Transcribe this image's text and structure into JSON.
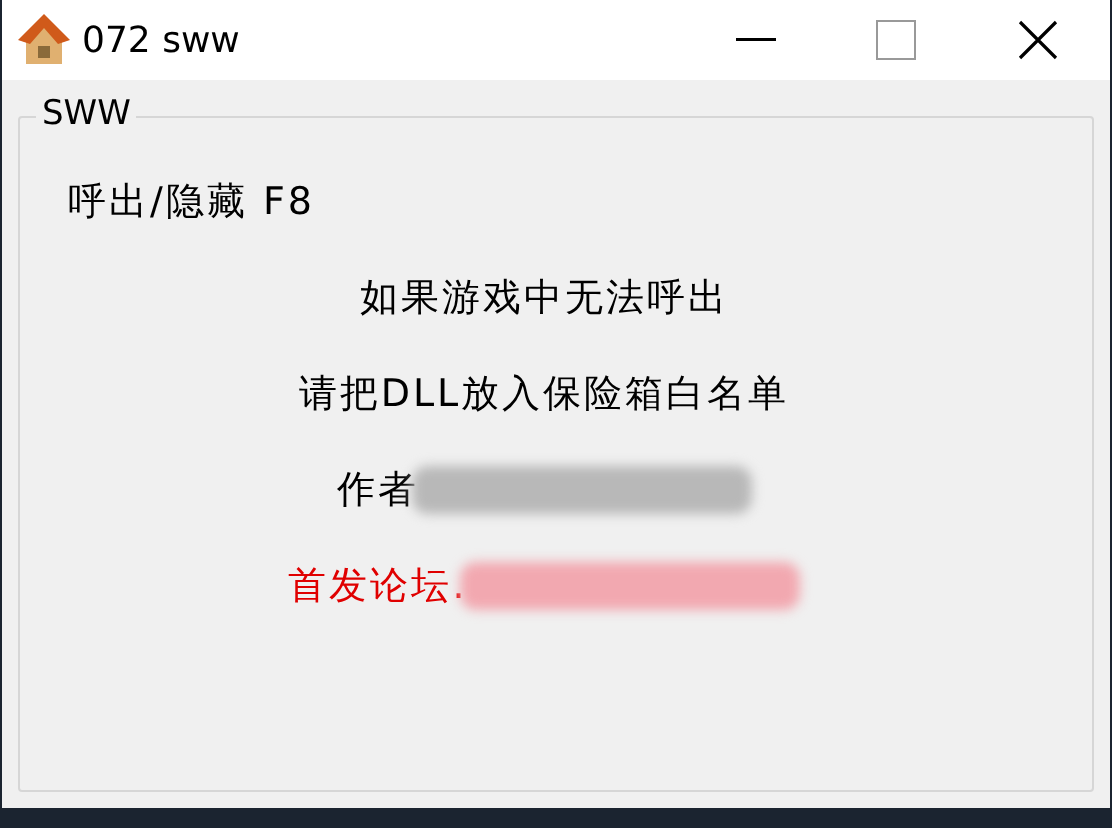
{
  "window": {
    "title": "072 sww"
  },
  "group": {
    "title": "SWW",
    "lines": [
      {
        "text": "呼出/隐藏 F8",
        "kind": "hotkey",
        "color": "#000000"
      },
      {
        "text": "如果游戏中无法呼出",
        "kind": "note",
        "color": "#000000"
      },
      {
        "text": "请把DLL放入保险箱白名单",
        "kind": "note",
        "color": "#000000"
      },
      {
        "text": "作者",
        "kind": "note",
        "color": "#000000",
        "blurred": true
      },
      {
        "text": "首发论坛.",
        "kind": "note",
        "color": "#e00000",
        "blurred": true
      }
    ]
  }
}
